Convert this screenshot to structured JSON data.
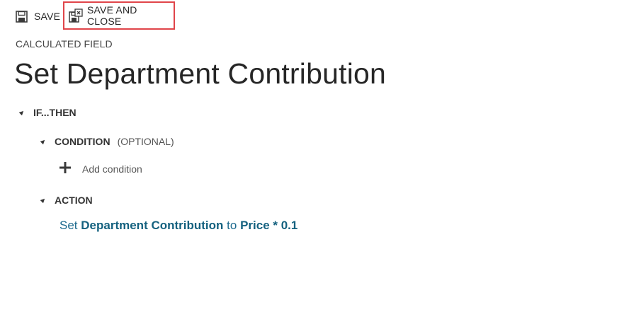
{
  "toolbar": {
    "save_label": "SAVE",
    "save_and_close_label": "SAVE AND CLOSE",
    "save_icon": "floppy-disk-icon",
    "save_and_close_icon": "save-and-close-icon",
    "highlight_color": "#e0454a"
  },
  "header": {
    "eyebrow": "CALCULATED FIELD",
    "title": "Set Department Contribution"
  },
  "rule": {
    "if_then_label": "IF...THEN",
    "condition": {
      "label": "CONDITION",
      "sublabel": "(OPTIONAL)",
      "add_label": "Add condition"
    },
    "action": {
      "label": "ACTION",
      "prefix": "Set",
      "field": "Department Contribution",
      "connector": "to",
      "expression": "Price * 0.1",
      "color": "#1d6a8e"
    }
  }
}
